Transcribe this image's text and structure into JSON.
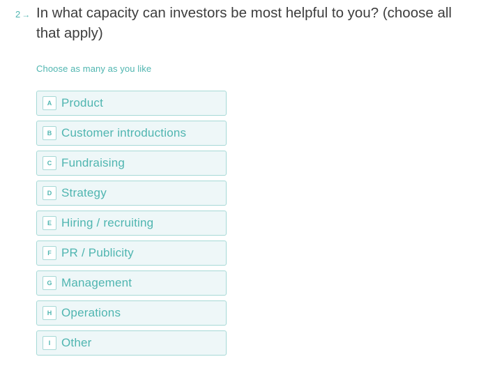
{
  "question": {
    "number": "2",
    "arrow_icon": "right-arrow-icon",
    "title": "In what capacity can investors be most helpful to you? (choose all that apply)",
    "hint": "Choose as many as you like"
  },
  "choices": [
    {
      "key": "A",
      "label": "Product"
    },
    {
      "key": "B",
      "label": "Customer introductions"
    },
    {
      "key": "C",
      "label": "Fundraising"
    },
    {
      "key": "D",
      "label": "Strategy"
    },
    {
      "key": "E",
      "label": "Hiring / recruiting"
    },
    {
      "key": "F",
      "label": "PR / Publicity"
    },
    {
      "key": "G",
      "label": "Management"
    },
    {
      "key": "H",
      "label": "Operations"
    },
    {
      "key": "I",
      "label": "Other"
    }
  ],
  "colors": {
    "accent": "#4fb5b0",
    "title_text": "#3d3d3d",
    "choice_bg": "#eef7f8",
    "choice_border": "#a6d9d6"
  }
}
